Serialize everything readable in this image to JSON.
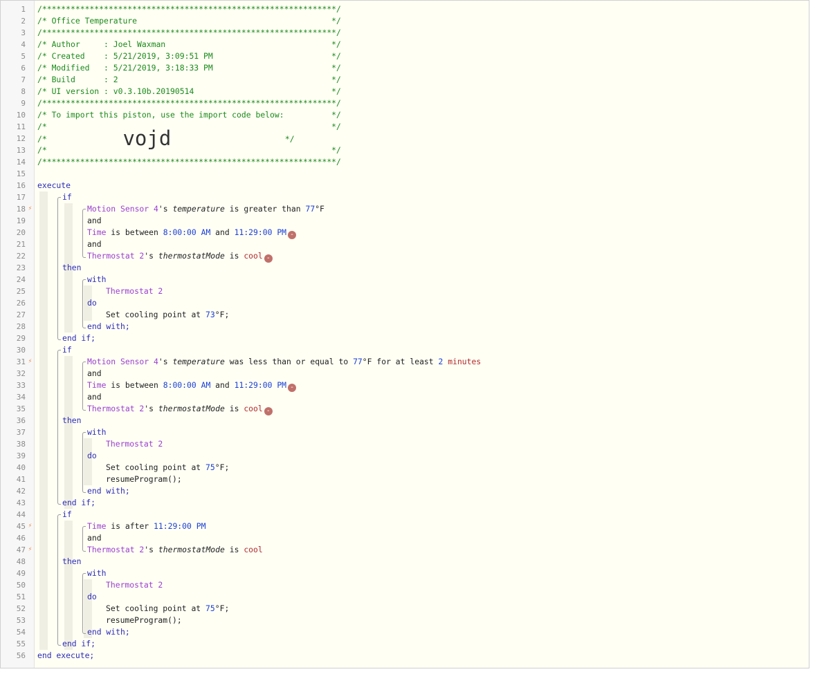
{
  "lines": [
    [
      {
        "c": "cm",
        "t": "/**************************************************************/"
      }
    ],
    [
      {
        "c": "cm",
        "t": "/* Office Temperature                                         */"
      }
    ],
    [
      {
        "c": "cm",
        "t": "/**************************************************************/"
      }
    ],
    [
      {
        "c": "cm",
        "t": "/* Author     : Joel Waxman                                   */"
      }
    ],
    [
      {
        "c": "cm",
        "t": "/* Created    : 5/21/2019, 3:09:51 PM                         */"
      }
    ],
    [
      {
        "c": "cm",
        "t": "/* Modified   : 5/21/2019, 3:18:33 PM                         */"
      }
    ],
    [
      {
        "c": "cm",
        "t": "/* Build      : 2                                             */"
      }
    ],
    [
      {
        "c": "cm",
        "t": "/* UI version : v0.3.10b.20190514                             */"
      }
    ],
    [
      {
        "c": "cm",
        "t": "/**************************************************************/"
      }
    ],
    [
      {
        "c": "cm",
        "t": "/* To import this piston, use the import code below:          */"
      }
    ],
    [
      {
        "c": "cm",
        "t": "/*                                                            */"
      }
    ],
    [
      {
        "c": "cm",
        "t": "/*                "
      },
      {
        "c": "big",
        "t": "vojd"
      },
      {
        "c": "cm",
        "t": "                        */"
      }
    ],
    [
      {
        "c": "cm",
        "t": "/*                                                            */"
      }
    ],
    [
      {
        "c": "cm",
        "t": "/**************************************************************/"
      }
    ],
    [],
    [
      {
        "c": "kw",
        "t": "execute"
      }
    ],
    [
      {
        "c": "kw",
        "t": "if"
      }
    ],
    [
      {
        "c": "dev",
        "t": "Motion Sensor 4"
      },
      {
        "c": "txt",
        "t": "'s "
      },
      {
        "c": "attr",
        "t": "temperature"
      },
      {
        "c": "txt",
        "t": " is greater than "
      },
      {
        "c": "val",
        "t": "77"
      },
      {
        "c": "txt",
        "t": "°F"
      }
    ],
    [
      {
        "c": "txt",
        "t": "and"
      }
    ],
    [
      {
        "c": "dev",
        "t": "Time"
      },
      {
        "c": "txt",
        "t": " is between "
      },
      {
        "c": "val",
        "t": "8:00:00 AM"
      },
      {
        "c": "txt",
        "t": " and "
      },
      {
        "c": "val",
        "t": "11:29:00 PM"
      },
      {
        "c": "rm",
        "t": "-"
      }
    ],
    [
      {
        "c": "txt",
        "t": "and"
      }
    ],
    [
      {
        "c": "dev",
        "t": "Thermostat 2"
      },
      {
        "c": "txt",
        "t": "'s "
      },
      {
        "c": "attr",
        "t": "thermostatMode"
      },
      {
        "c": "txt",
        "t": " is "
      },
      {
        "c": "str",
        "t": "cool"
      },
      {
        "c": "rm",
        "t": "-"
      }
    ],
    [
      {
        "c": "kw",
        "t": "then"
      }
    ],
    [
      {
        "c": "kw",
        "t": "with"
      }
    ],
    [
      {
        "c": "dev",
        "t": "Thermostat 2"
      }
    ],
    [
      {
        "c": "kw",
        "t": "do"
      }
    ],
    [
      {
        "c": "txt",
        "t": "Set cooling point at "
      },
      {
        "c": "val",
        "t": "73"
      },
      {
        "c": "txt",
        "t": "°F;"
      }
    ],
    [
      {
        "c": "kw",
        "t": "end with;"
      }
    ],
    [
      {
        "c": "kw",
        "t": "end if;"
      }
    ],
    [
      {
        "c": "kw",
        "t": "if"
      }
    ],
    [
      {
        "c": "dev",
        "t": "Motion Sensor 4"
      },
      {
        "c": "txt",
        "t": "'s "
      },
      {
        "c": "attr",
        "t": "temperature"
      },
      {
        "c": "txt",
        "t": " was less than or equal to "
      },
      {
        "c": "val",
        "t": "77"
      },
      {
        "c": "txt",
        "t": "°F for at least "
      },
      {
        "c": "val",
        "t": "2"
      },
      {
        "c": "txt",
        "t": " "
      },
      {
        "c": "str",
        "t": "minutes"
      }
    ],
    [
      {
        "c": "txt",
        "t": "and"
      }
    ],
    [
      {
        "c": "dev",
        "t": "Time"
      },
      {
        "c": "txt",
        "t": " is between "
      },
      {
        "c": "val",
        "t": "8:00:00 AM"
      },
      {
        "c": "txt",
        "t": " and "
      },
      {
        "c": "val",
        "t": "11:29:00 PM"
      },
      {
        "c": "rm",
        "t": "-"
      }
    ],
    [
      {
        "c": "txt",
        "t": "and"
      }
    ],
    [
      {
        "c": "dev",
        "t": "Thermostat 2"
      },
      {
        "c": "txt",
        "t": "'s "
      },
      {
        "c": "attr",
        "t": "thermostatMode"
      },
      {
        "c": "txt",
        "t": " is "
      },
      {
        "c": "str",
        "t": "cool"
      },
      {
        "c": "rm",
        "t": "-"
      }
    ],
    [
      {
        "c": "kw",
        "t": "then"
      }
    ],
    [
      {
        "c": "kw",
        "t": "with"
      }
    ],
    [
      {
        "c": "dev",
        "t": "Thermostat 2"
      }
    ],
    [
      {
        "c": "kw",
        "t": "do"
      }
    ],
    [
      {
        "c": "txt",
        "t": "Set cooling point at "
      },
      {
        "c": "val",
        "t": "75"
      },
      {
        "c": "txt",
        "t": "°F;"
      }
    ],
    [
      {
        "c": "txt",
        "t": "resumeProgram();"
      }
    ],
    [
      {
        "c": "kw",
        "t": "end with;"
      }
    ],
    [
      {
        "c": "kw",
        "t": "end if;"
      }
    ],
    [
      {
        "c": "kw",
        "t": "if"
      }
    ],
    [
      {
        "c": "dev",
        "t": "Time"
      },
      {
        "c": "txt",
        "t": " is after "
      },
      {
        "c": "val",
        "t": "11:29:00 PM"
      }
    ],
    [
      {
        "c": "txt",
        "t": "and"
      }
    ],
    [
      {
        "c": "dev",
        "t": "Thermostat 2"
      },
      {
        "c": "txt",
        "t": "'s "
      },
      {
        "c": "attr",
        "t": "thermostatMode"
      },
      {
        "c": "txt",
        "t": " is "
      },
      {
        "c": "str",
        "t": "cool"
      }
    ],
    [
      {
        "c": "kw",
        "t": "then"
      }
    ],
    [
      {
        "c": "kw",
        "t": "with"
      }
    ],
    [
      {
        "c": "dev",
        "t": "Thermostat 2"
      }
    ],
    [
      {
        "c": "kw",
        "t": "do"
      }
    ],
    [
      {
        "c": "txt",
        "t": "Set cooling point at "
      },
      {
        "c": "val",
        "t": "75"
      },
      {
        "c": "txt",
        "t": "°F;"
      }
    ],
    [
      {
        "c": "txt",
        "t": "resumeProgram();"
      }
    ],
    [
      {
        "c": "kw",
        "t": "end with;"
      }
    ],
    [
      {
        "c": "kw",
        "t": "end if;"
      }
    ],
    [
      {
        "c": "kw",
        "t": "end execute;"
      }
    ]
  ],
  "trigger_lines": [
    18,
    31,
    45,
    47
  ],
  "trigger_icon": "lightning-bolt-icon",
  "colors": {
    "comment": "#1a8a1a",
    "keyword": "#2c2cb8",
    "device": "#9a3fd0",
    "value": "#1a3fd8",
    "string": "#b12a2a",
    "trigger": "#f0883e",
    "remove_badge": "#c0706a"
  }
}
